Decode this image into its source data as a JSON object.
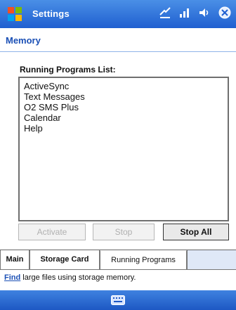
{
  "title_bar": {
    "title": "Settings"
  },
  "subheader": {
    "caption": "Memory"
  },
  "running_programs": {
    "label": "Running Programs List:",
    "items": [
      "ActiveSync",
      "Text Messages",
      "O2 SMS Plus",
      "Calendar",
      "Help"
    ]
  },
  "buttons": {
    "activate": "Activate",
    "stop": "Stop",
    "stop_all": "Stop All"
  },
  "tabs": {
    "main": "Main",
    "storage_card": "Storage Card",
    "running_programs": "Running Programs"
  },
  "hint": {
    "link": "Find",
    "text": " large files using storage memory."
  },
  "icons": {
    "start": "windows-flag-icon",
    "connectivity": "connectivity-icon",
    "signal": "signal-icon",
    "volume": "speaker-icon",
    "ok": "close-ok-icon",
    "keyboard": "keyboard-icon"
  },
  "colors": {
    "title_bar": "#1f5fd0",
    "accent_text": "#1a4fb5",
    "menu_bar": "#1d58c4"
  }
}
